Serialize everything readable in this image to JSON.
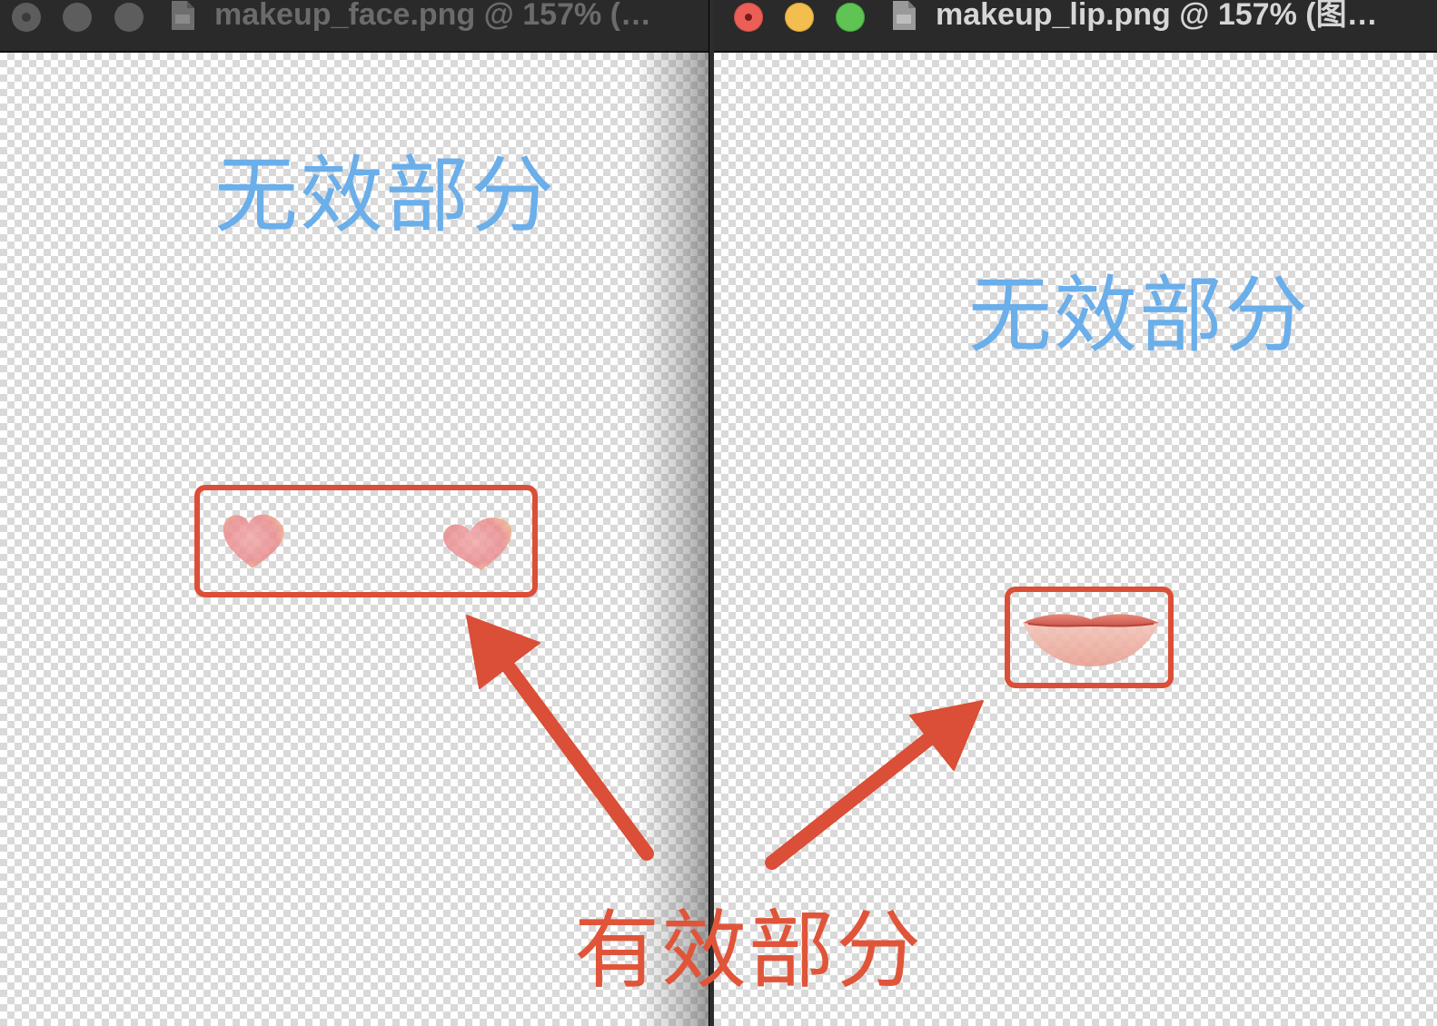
{
  "windows": {
    "left": {
      "title": "makeup_face.png @ 157% (…",
      "invalid_label": "无效部分"
    },
    "right": {
      "title": "makeup_lip.png @ 157% (图…",
      "invalid_label": "无效部分"
    }
  },
  "annotation": {
    "valid_label": "有效部分"
  },
  "colors": {
    "invalid_text": "#6aaeea",
    "annotation_red": "#db4e37",
    "titlebar": "#2a2a2a"
  },
  "icons": {
    "document": "png-file-icon",
    "left_content": "heart-blush-icon",
    "right_content": "lips-icon"
  }
}
